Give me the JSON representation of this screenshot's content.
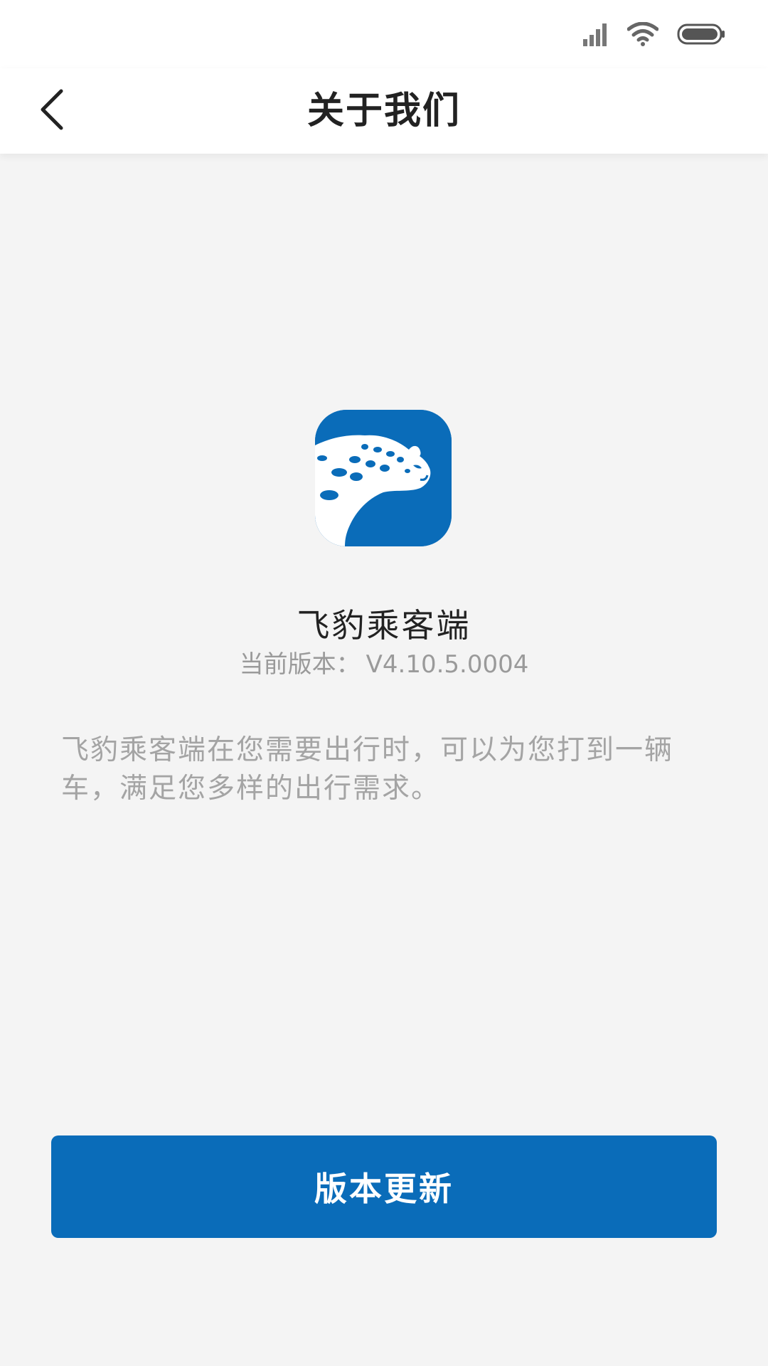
{
  "header": {
    "title": "关于我们"
  },
  "app": {
    "name": "飞豹乘客端",
    "version_label": "当前版本：",
    "version_value": "V4.10.5.0004",
    "description": "飞豹乘客端在您需要出行时，可以为您打到一辆车，满足您多样的出行需求。"
  },
  "actions": {
    "update_label": "版本更新"
  },
  "icons": {
    "status": [
      "signal-icon",
      "wifi-icon",
      "battery-icon"
    ],
    "back": "chevron-left-icon",
    "logo": "leopard-logo-icon"
  },
  "colors": {
    "brand": "#0a6cb9",
    "title_text": "#222222",
    "muted_text": "#9a9a9a",
    "background": "#f4f4f4"
  }
}
